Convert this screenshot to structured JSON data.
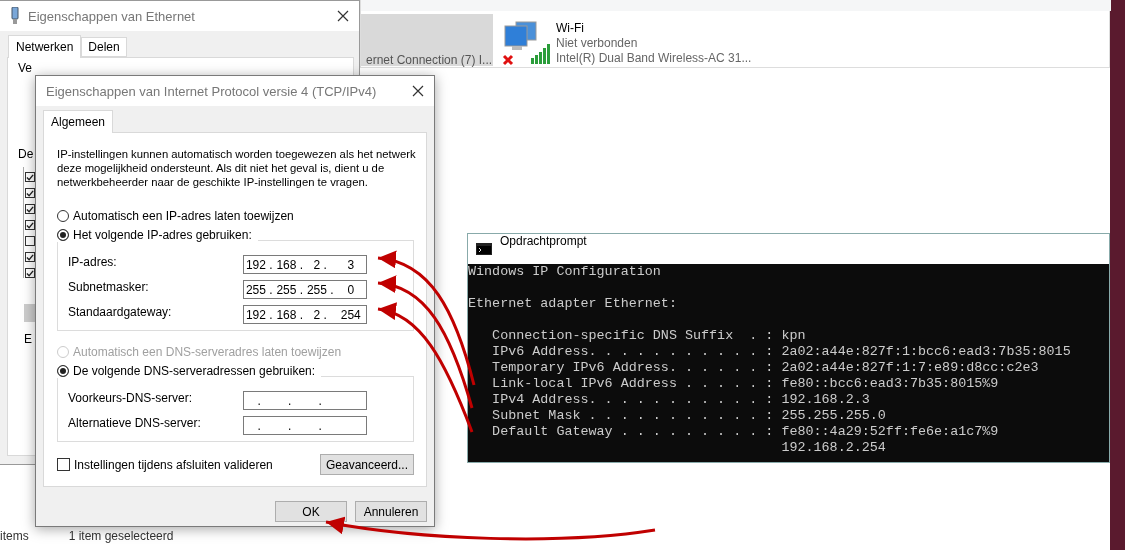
{
  "explorer": {
    "connection_name": "ernet Connection (7) I...",
    "wifi": {
      "name": "Wi-Fi",
      "status": "Niet verbonden",
      "adapter": "Intel(R) Dual Band Wireless-AC 31..."
    },
    "status_bar": {
      "count": "items",
      "selection": "1 item geselecteerd"
    }
  },
  "ethernet_dialog": {
    "title": "Eigenschappen van Ethernet",
    "tabs": [
      {
        "label": "Netwerken",
        "selected": true
      },
      {
        "label": "Delen",
        "selected": false
      }
    ],
    "labels": [
      "Ve",
      "De",
      "E"
    ],
    "components": [
      {
        "checked": true
      },
      {
        "checked": true
      },
      {
        "checked": true
      },
      {
        "checked": true
      },
      {
        "checked": false
      },
      {
        "checked": true
      },
      {
        "checked": true
      }
    ]
  },
  "ipv4_dialog": {
    "title": "Eigenschappen van Internet Protocol versie 4 (TCP/IPv4)",
    "tabs": [
      {
        "label": "Algemeen",
        "selected": true
      }
    ],
    "intro": "IP-instellingen kunnen automatisch worden toegewezen als het netwerk deze mogelijkheid ondersteunt. Als dit niet het geval is, dient u de netwerkbeheerder naar de geschikte IP-instellingen te vragen.",
    "separator": ".",
    "ip_options": [
      {
        "label": "Automatisch een IP-adres laten toewijzen",
        "selected": false,
        "disabled": false
      },
      {
        "label": "Het volgende IP-adres gebruiken:",
        "selected": true,
        "disabled": false
      }
    ],
    "ip_fields": [
      {
        "label": "IP-adres:",
        "octets": [
          "192",
          "168",
          "2",
          "3"
        ]
      },
      {
        "label": "Subnetmasker:",
        "octets": [
          "255",
          "255",
          "255",
          "0"
        ]
      },
      {
        "label": "Standaardgateway:",
        "octets": [
          "192",
          "168",
          "2",
          "254"
        ]
      }
    ],
    "dns_options": [
      {
        "label": "Automatisch een DNS-serveradres laten toewijzen",
        "selected": false,
        "disabled": true
      },
      {
        "label": "De volgende DNS-serveradressen gebruiken:",
        "selected": true,
        "disabled": false
      }
    ],
    "dns_fields": [
      {
        "label": "Voorkeurs-DNS-server:"
      },
      {
        "label": "Alternatieve DNS-server:"
      }
    ],
    "validate_checkbox": {
      "label": "Instellingen tijdens afsluiten valideren",
      "checked": false
    },
    "advanced_button": "Geavanceerd...",
    "buttons": [
      "OK",
      "Annuleren"
    ]
  },
  "command_prompt": {
    "title": "Opdrachtprompt",
    "blocks": [
      [
        "Windows IP Configuration"
      ],
      [
        "Ethernet adapter Ethernet:"
      ],
      [
        "   Connection-specific DNS Suffix  . : kpn",
        "   IPv6 Address. . . . . . . . . . . : 2a02:a44e:827f:1:bcc6:ead3:7b35:8015",
        "   Temporary IPv6 Address. . . . . . : 2a02:a44e:827f:1:7:e89:d8cc:c2e3",
        "   Link-local IPv6 Address . . . . . : fe80::bcc6:ead3:7b35:8015%9",
        "   IPv4 Address. . . . . . . . . . . : 192.168.2.3",
        "   Subnet Mask . . . . . . . . . . . : 255.255.255.0",
        "   Default Gateway . . . . . . . . . : fe80::4a29:52ff:fe6e:a1c7%9",
        "                                       192.168.2.254"
      ]
    ]
  }
}
